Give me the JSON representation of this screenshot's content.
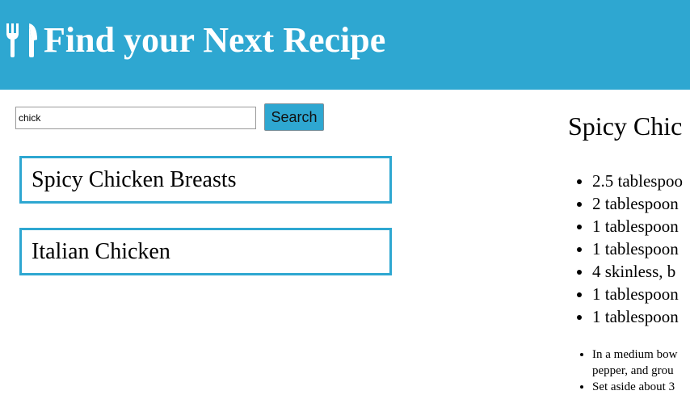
{
  "header": {
    "title": "Find your Next Recipe",
    "icon": "utensils-icon",
    "background": "#2ea7d1"
  },
  "search": {
    "value": "chick",
    "button_label": "Search"
  },
  "results": [
    {
      "label": "Spicy Chicken Breasts"
    },
    {
      "label": "Italian Chicken"
    }
  ],
  "detail": {
    "title": "Spicy Chic",
    "ingredients": [
      "2.5 tablespoo",
      "2 tablespoon",
      "1 tablespoon",
      "1 tablespoon",
      "4 skinless, b",
      "1 tablespoon",
      "1 tablespoon"
    ],
    "steps": [
      "In a medium bow\npepper, and grou",
      "Set aside about 3"
    ]
  },
  "colors": {
    "accent": "#2ea7d1",
    "border": "#2ea7d1"
  }
}
